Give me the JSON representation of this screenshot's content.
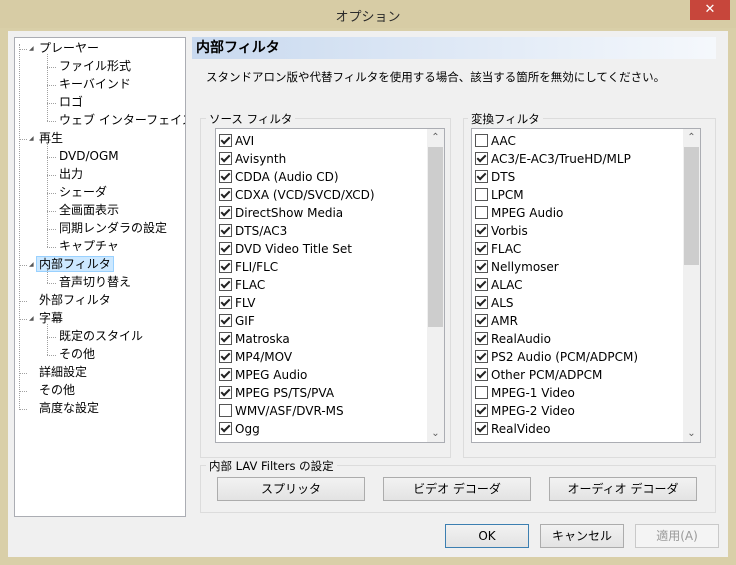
{
  "window": {
    "title": "オプション",
    "close": "✕"
  },
  "tree": {
    "items": [
      {
        "label": "プレーヤー",
        "level": 0,
        "expandable": true
      },
      {
        "label": "ファイル形式",
        "level": 1
      },
      {
        "label": "キーバインド",
        "level": 1
      },
      {
        "label": "ロゴ",
        "level": 1
      },
      {
        "label": "ウェブ インターフェイス",
        "level": 1
      },
      {
        "label": "再生",
        "level": 0,
        "expandable": true
      },
      {
        "label": "DVD/OGM",
        "level": 1
      },
      {
        "label": "出力",
        "level": 1
      },
      {
        "label": "シェーダ",
        "level": 1
      },
      {
        "label": "全画面表示",
        "level": 1
      },
      {
        "label": "同期レンダラの設定",
        "level": 1
      },
      {
        "label": "キャプチャ",
        "level": 1
      },
      {
        "label": "内部フィルタ",
        "level": 0,
        "expandable": true,
        "selected": true
      },
      {
        "label": "音声切り替え",
        "level": 1
      },
      {
        "label": "外部フィルタ",
        "level": 0
      },
      {
        "label": "字幕",
        "level": 0,
        "expandable": true
      },
      {
        "label": "既定のスタイル",
        "level": 1
      },
      {
        "label": "その他",
        "level": 1
      },
      {
        "label": "詳細設定",
        "level": 0
      },
      {
        "label": "その他",
        "level": 0
      },
      {
        "label": "高度な設定",
        "level": 0
      }
    ]
  },
  "panel": {
    "title": "内部フィルタ",
    "description": "スタンドアロン版や代替フィルタを使用する場合、該当する箇所を無効にしてください。"
  },
  "source_filters": {
    "label": "ソース フィルタ",
    "items": [
      {
        "label": "AVI",
        "checked": true
      },
      {
        "label": "Avisynth",
        "checked": true
      },
      {
        "label": "CDDA (Audio CD)",
        "checked": true
      },
      {
        "label": "CDXA (VCD/SVCD/XCD)",
        "checked": true
      },
      {
        "label": "DirectShow Media",
        "checked": true
      },
      {
        "label": "DTS/AC3",
        "checked": true
      },
      {
        "label": "DVD Video Title Set",
        "checked": true
      },
      {
        "label": "FLI/FLC",
        "checked": true
      },
      {
        "label": "FLAC",
        "checked": true
      },
      {
        "label": "FLV",
        "checked": true
      },
      {
        "label": "GIF",
        "checked": true
      },
      {
        "label": "Matroska",
        "checked": true
      },
      {
        "label": "MP4/MOV",
        "checked": true
      },
      {
        "label": "MPEG Audio",
        "checked": true
      },
      {
        "label": "MPEG PS/TS/PVA",
        "checked": true
      },
      {
        "label": "WMV/ASF/DVR-MS",
        "checked": false
      },
      {
        "label": "Ogg",
        "checked": true
      }
    ]
  },
  "transform_filters": {
    "label": "変換フィルタ",
    "items": [
      {
        "label": "AAC",
        "checked": false
      },
      {
        "label": "AC3/E-AC3/TrueHD/MLP",
        "checked": true
      },
      {
        "label": "DTS",
        "checked": true
      },
      {
        "label": "LPCM",
        "checked": false
      },
      {
        "label": "MPEG Audio",
        "checked": false
      },
      {
        "label": "Vorbis",
        "checked": true
      },
      {
        "label": "FLAC",
        "checked": true
      },
      {
        "label": "Nellymoser",
        "checked": true
      },
      {
        "label": "ALAC",
        "checked": true
      },
      {
        "label": "ALS",
        "checked": true
      },
      {
        "label": "AMR",
        "checked": true
      },
      {
        "label": "RealAudio",
        "checked": true
      },
      {
        "label": "PS2 Audio (PCM/ADPCM)",
        "checked": true
      },
      {
        "label": "Other PCM/ADPCM",
        "checked": true
      },
      {
        "label": "MPEG-1 Video",
        "checked": false
      },
      {
        "label": "MPEG-2 Video",
        "checked": true
      },
      {
        "label": "RealVideo",
        "checked": true
      }
    ]
  },
  "lav": {
    "label": "内部 LAV Filters の設定",
    "splitter": "スプリッタ",
    "video": "ビデオ デコーダ",
    "audio": "オーディオ デコーダ"
  },
  "buttons": {
    "ok": "OK",
    "cancel": "キャンセル",
    "apply": "適用(A)"
  },
  "scroll": {
    "up": "⌃",
    "down": "⌄"
  }
}
